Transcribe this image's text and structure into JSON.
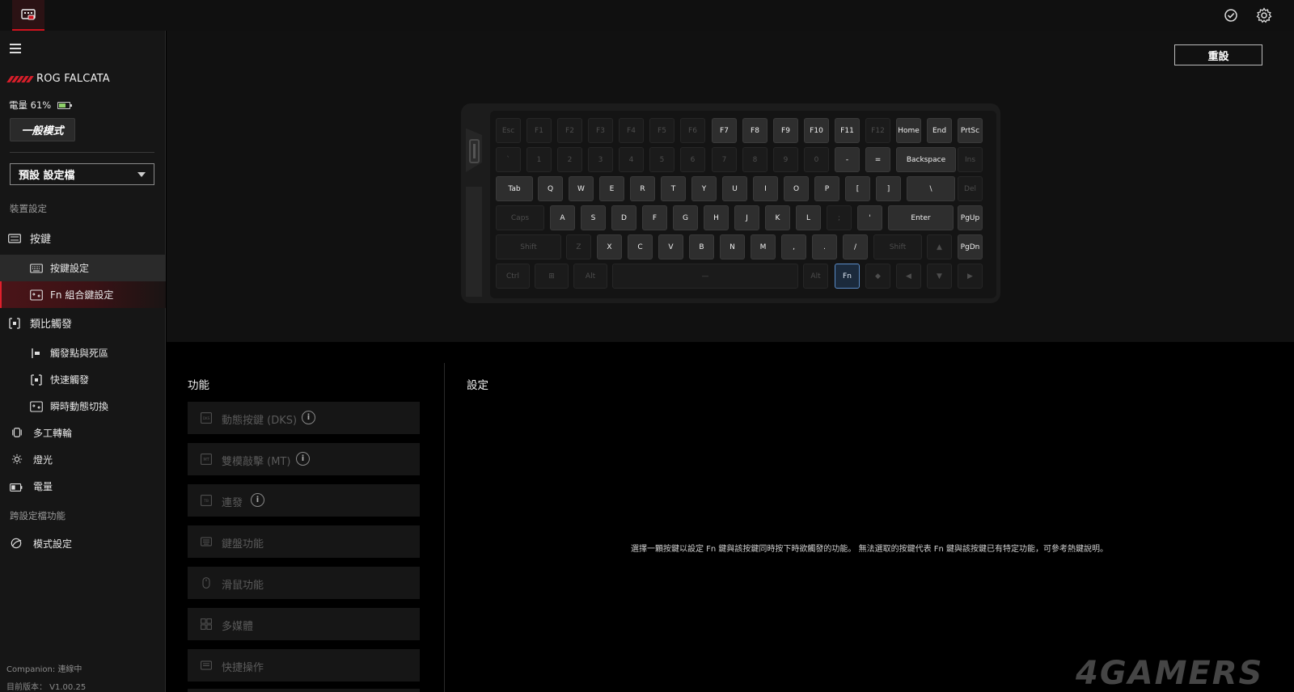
{
  "topbar": {
    "app_icon": "keyboard-device-icon",
    "right_icons": [
      "update-check-icon",
      "gear-icon"
    ]
  },
  "sidebar": {
    "device_name": "ROG FALCATA",
    "battery_label": "電量 61%",
    "battery_level": 0.61,
    "mode_button": "一般模式",
    "profile_select": "預設 設定檔",
    "section_device": "裝置設定",
    "section_cross": "跨設定檔功能",
    "items": [
      {
        "label": "按鍵",
        "icon": "keyboard-icon"
      },
      {
        "label": "按鍵設定",
        "icon": "keyboard-small-icon"
      },
      {
        "label": "Fn 組合鍵設定",
        "icon": "fn-combo-icon"
      },
      {
        "label": "類比觸發",
        "icon": "analog-trigger-icon"
      },
      {
        "label": "觸發點與死區",
        "icon": "actuation-point-icon"
      },
      {
        "label": "快速觸發",
        "icon": "rapid-trigger-icon"
      },
      {
        "label": "瞬時動態切換",
        "icon": "dynamic-switch-icon"
      },
      {
        "label": "多工轉輪",
        "icon": "dial-icon"
      },
      {
        "label": "燈光",
        "icon": "lighting-icon"
      },
      {
        "label": "電量",
        "icon": "battery-icon"
      },
      {
        "label": "模式設定",
        "icon": "mode-icon"
      }
    ],
    "footer_status": "Companion: 連線中",
    "footer_version": "目前版本： V1.00.25"
  },
  "keyboard": {
    "reset_button": "重設",
    "rows": [
      [
        {
          "l": "Esc",
          "d": true
        },
        {
          "l": "F1",
          "d": true
        },
        {
          "l": "F2",
          "d": true
        },
        {
          "l": "F3",
          "d": true
        },
        {
          "l": "F4",
          "d": true
        },
        {
          "l": "F5",
          "d": true
        },
        {
          "l": "F6",
          "d": true
        },
        {
          "l": "F7"
        },
        {
          "l": "F8"
        },
        {
          "l": "F9"
        },
        {
          "l": "F10"
        },
        {
          "l": "F11"
        },
        {
          "l": "F12",
          "d": true
        },
        {
          "l": "Home"
        },
        {
          "l": "End"
        },
        {
          "l": "PrtSc"
        }
      ],
      [
        {
          "l": "`",
          "d": true
        },
        {
          "l": "1",
          "d": true
        },
        {
          "l": "2",
          "d": true
        },
        {
          "l": "3",
          "d": true
        },
        {
          "l": "4",
          "d": true
        },
        {
          "l": "5",
          "d": true
        },
        {
          "l": "6",
          "d": true
        },
        {
          "l": "7",
          "d": true
        },
        {
          "l": "8",
          "d": true
        },
        {
          "l": "9",
          "d": true
        },
        {
          "l": "0",
          "d": true
        },
        {
          "l": "-"
        },
        {
          "l": "="
        },
        {
          "l": "Backspace"
        },
        {
          "l": "Ins",
          "d": true
        }
      ],
      [
        {
          "l": "Tab"
        },
        {
          "l": "Q"
        },
        {
          "l": "W"
        },
        {
          "l": "E"
        },
        {
          "l": "R"
        },
        {
          "l": "T"
        },
        {
          "l": "Y"
        },
        {
          "l": "U"
        },
        {
          "l": "I"
        },
        {
          "l": "O"
        },
        {
          "l": "P"
        },
        {
          "l": "["
        },
        {
          "l": "]"
        },
        {
          "l": "\\"
        },
        {
          "l": "Del",
          "d": true
        }
      ],
      [
        {
          "l": "Caps",
          "d": true
        },
        {
          "l": "A"
        },
        {
          "l": "S"
        },
        {
          "l": "D"
        },
        {
          "l": "F"
        },
        {
          "l": "G"
        },
        {
          "l": "H"
        },
        {
          "l": "J"
        },
        {
          "l": "K"
        },
        {
          "l": "L"
        },
        {
          "l": ";",
          "d": true
        },
        {
          "l": "'"
        },
        {
          "l": "Enter"
        },
        {
          "l": "PgUp"
        }
      ],
      [
        {
          "l": "Shift",
          "d": true
        },
        {
          "l": "Z",
          "d": true
        },
        {
          "l": "X"
        },
        {
          "l": "C"
        },
        {
          "l": "V"
        },
        {
          "l": "B"
        },
        {
          "l": "N"
        },
        {
          "l": "M"
        },
        {
          "l": ","
        },
        {
          "l": "."
        },
        {
          "l": "/"
        },
        {
          "l": "Shift",
          "d": true
        },
        {
          "l": "▲",
          "d": true
        },
        {
          "l": "PgDn"
        }
      ],
      [
        {
          "l": "Ctrl",
          "d": true
        },
        {
          "l": "⊞",
          "d": true
        },
        {
          "l": "Alt",
          "d": true
        },
        {
          "l": "—",
          "d": true
        },
        {
          "l": "Alt",
          "d": true
        },
        {
          "l": "Fn",
          "sel": true
        },
        {
          "l": "◆",
          "d": true
        },
        {
          "l": "◀",
          "d": true
        },
        {
          "l": "▼",
          "d": true
        },
        {
          "l": "▶",
          "d": true
        }
      ]
    ]
  },
  "function_panel": {
    "title": "功能",
    "items": [
      {
        "label": "動態按鍵 (DKS)",
        "icon": "dks-icon",
        "info": true
      },
      {
        "label": "雙模敲擊 (MT)",
        "icon": "mt-icon",
        "info": true
      },
      {
        "label": "連發",
        "icon": "turbo-icon",
        "info": true
      },
      {
        "label": "鍵盤功能",
        "icon": "keyboard-function-icon",
        "info": false
      },
      {
        "label": "滑鼠功能",
        "icon": "mouse-icon",
        "info": false
      },
      {
        "label": "多媒體",
        "icon": "multimedia-icon",
        "info": false
      },
      {
        "label": "快捷操作",
        "icon": "shortcut-icon",
        "info": false
      }
    ],
    "info_glyph": "i"
  },
  "settings_panel": {
    "title": "設定",
    "hint": "選擇一顆按鍵以設定 Fn 鍵與該按鍵同時按下時欲觸發的功能。 無法選取的按鍵代表 Fn 鍵與該按鍵已有特定功能，可參考熱鍵說明。"
  },
  "watermark": "4GAMERS"
}
